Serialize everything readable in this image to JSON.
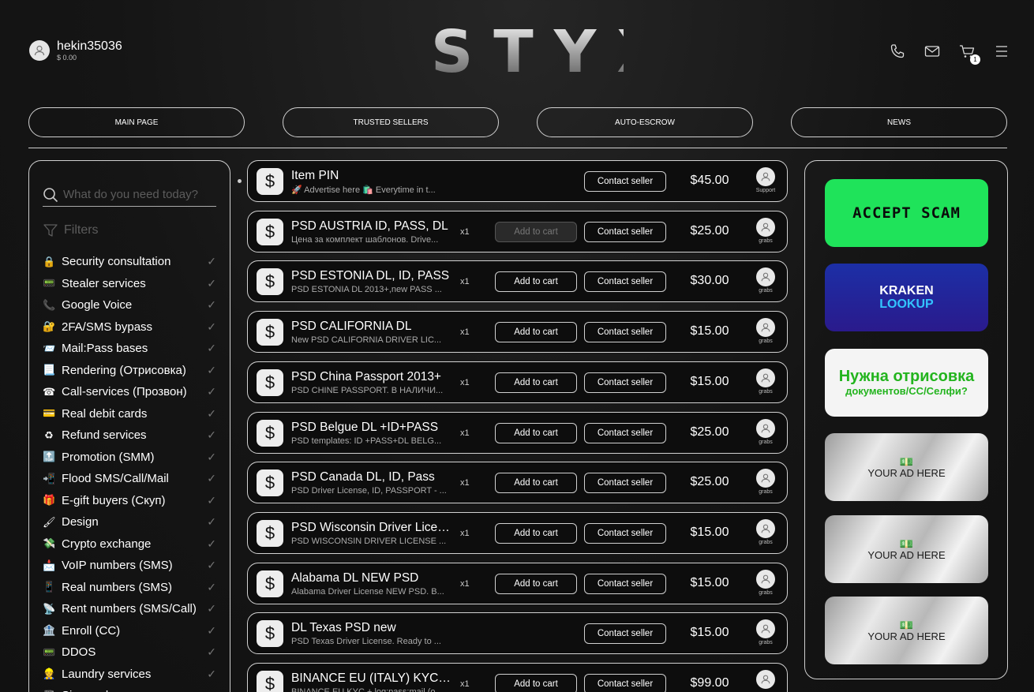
{
  "header": {
    "username": "hekin35036",
    "balance": "$ 0.00",
    "logo": "STYX",
    "cart_count": "1"
  },
  "nav": [
    "MAIN PAGE",
    "TRUSTED SELLERS",
    "AUTO-ESCROW",
    "NEWS"
  ],
  "sidebar": {
    "search_placeholder": "What do you need today?",
    "filters_label": "Filters",
    "categories": [
      {
        "icon": "🔒",
        "label": "Security consultation"
      },
      {
        "icon": "📟",
        "label": "Stealer services"
      },
      {
        "icon": "📞",
        "label": "Google Voice"
      },
      {
        "icon": "🔐",
        "label": "2FA/SMS bypass"
      },
      {
        "icon": "📨",
        "label": "Mail:Pass bases"
      },
      {
        "icon": "📃",
        "label": "Rendering (Отрисовка)"
      },
      {
        "icon": "☎",
        "label": "Call-services (Прозвон)"
      },
      {
        "icon": "💳",
        "label": "Real debit cards"
      },
      {
        "icon": "♻",
        "label": "Refund services"
      },
      {
        "icon": "🔝",
        "label": "Promotion (SMM)"
      },
      {
        "icon": "📲",
        "label": "Flood SMS/Call/Mail"
      },
      {
        "icon": "🎁",
        "label": "E-gift buyers (Скуп)"
      },
      {
        "icon": "🖌",
        "label": "Design"
      },
      {
        "icon": "💸",
        "label": "Crypto exchange"
      },
      {
        "icon": "📩",
        "label": "VoIP numbers (SMS)"
      },
      {
        "icon": "📱",
        "label": "Real numbers (SMS)"
      },
      {
        "icon": "📡",
        "label": "Rent numbers (SMS/Call)"
      },
      {
        "icon": "🏦",
        "label": "Enroll (CC)"
      },
      {
        "icon": "📟",
        "label": "DDOS"
      },
      {
        "icon": "👷",
        "label": "Laundry services"
      },
      {
        "icon": "📓",
        "label": "Sim cards"
      }
    ]
  },
  "listings": [
    {
      "title": "Item PIN",
      "desc": "🚀 Advertise here 🛍️ Everytime in t...",
      "qty": "",
      "add": "",
      "add_disabled": false,
      "contact": "Contact seller",
      "price": "$45.00",
      "seller": "Support"
    },
    {
      "title": "PSD AUSTRIA ID, PASS, DL",
      "desc": "Цена за комплект шаблонов. Drive...",
      "qty": "x1",
      "add": "Add to cart",
      "add_disabled": true,
      "contact": "Contact seller",
      "price": "$25.00",
      "seller": "grabs"
    },
    {
      "title": "PSD ESTONIA DL, ID, PASS",
      "desc": "PSD ESTONIA DL 2013+,new PASS ...",
      "qty": "x1",
      "add": "Add to cart",
      "add_disabled": false,
      "contact": "Contact seller",
      "price": "$30.00",
      "seller": "grabs"
    },
    {
      "title": "PSD CALIFORNIA DL",
      "desc": "New PSD CALIFORNIA DRIVER LIC...",
      "qty": "x1",
      "add": "Add to cart",
      "add_disabled": false,
      "contact": "Contact seller",
      "price": "$15.00",
      "seller": "grabs"
    },
    {
      "title": "PSD China Passport 2013+",
      "desc": "PSD CHINE PASSPORT. В НАЛИЧИ...",
      "qty": "x1",
      "add": "Add to cart",
      "add_disabled": false,
      "contact": "Contact seller",
      "price": "$15.00",
      "seller": "grabs"
    },
    {
      "title": "PSD Belgue DL +ID+PASS",
      "desc": "PSD templates: ID +PASS+DL BELG...",
      "qty": "x1",
      "add": "Add to cart",
      "add_disabled": false,
      "contact": "Contact seller",
      "price": "$25.00",
      "seller": "grabs"
    },
    {
      "title": "PSD Canada DL, ID, Pass",
      "desc": "PSD Driver License, ID, PASSPORT - ...",
      "qty": "x1",
      "add": "Add to cart",
      "add_disabled": false,
      "contact": "Contact seller",
      "price": "$25.00",
      "seller": "grabs"
    },
    {
      "title": "PSD Wisconsin Driver Licen...",
      "desc": "PSD WISCONSIN DRIVER LICENSE ...",
      "qty": "x1",
      "add": "Add to cart",
      "add_disabled": false,
      "contact": "Contact seller",
      "price": "$15.00",
      "seller": "grabs"
    },
    {
      "title": "Alabama DL NEW PSD",
      "desc": "Alabama Driver License NEW PSD. B...",
      "qty": "x1",
      "add": "Add to cart",
      "add_disabled": false,
      "contact": "Contact seller",
      "price": "$15.00",
      "seller": "grabs"
    },
    {
      "title": "DL Texas PSD new",
      "desc": "PSD Texas Driver License. Ready to ...",
      "qty": "",
      "add": "",
      "add_disabled": false,
      "contact": "Contact seller",
      "price": "$15.00",
      "seller": "grabs"
    },
    {
      "title": "BINANCE EU (ITALY) KYC +...",
      "desc": "BINANCE EU KYC + log:pass:mail (o...",
      "qty": "x1",
      "add": "Add to cart",
      "add_disabled": false,
      "contact": "Contact seller",
      "price": "$99.00",
      "seller": ""
    }
  ],
  "ads": {
    "ad1": "ACCEPT SCAM",
    "ad2_line1": "KRAKEN",
    "ad2_line2": "LOOKUP",
    "ad3_line1": "Нужна отрисовка",
    "ad3_line2": "документов/CC/Селфи?",
    "placeholder": "YOUR AD HERE"
  }
}
